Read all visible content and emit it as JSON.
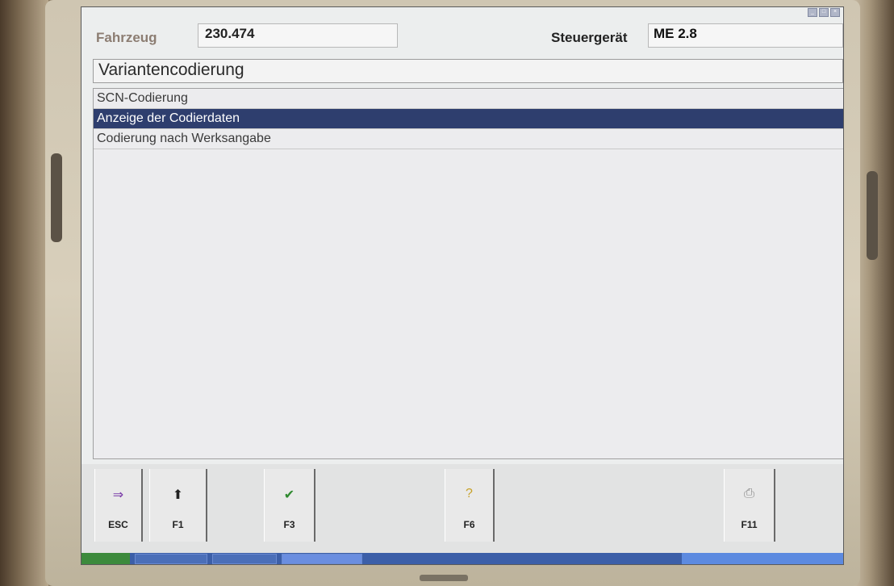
{
  "header": {
    "vehicle_label": "Fahrzeug",
    "vehicle_value": "230.474",
    "ecu_label": "Steuergerät",
    "ecu_value": "ME 2.8"
  },
  "section_title": "Variantencodierung",
  "menu": {
    "items": [
      {
        "label": "SCN-Codierung",
        "selected": false
      },
      {
        "label": "Anzeige der Codierdaten",
        "selected": true
      },
      {
        "label": "Codierung nach Werksangabe",
        "selected": false
      }
    ]
  },
  "function_keys": [
    {
      "label": "ESC",
      "icon": "exit-icon"
    },
    {
      "label": "F1",
      "icon": "arrow-up-icon"
    },
    {
      "label": "F3",
      "icon": "checkmark-icon"
    },
    {
      "label": "F6",
      "icon": "help-icon"
    },
    {
      "label": "F11",
      "icon": "printer-icon"
    }
  ],
  "colors": {
    "selection": "#2e3e6e",
    "background": "#eceeee"
  }
}
